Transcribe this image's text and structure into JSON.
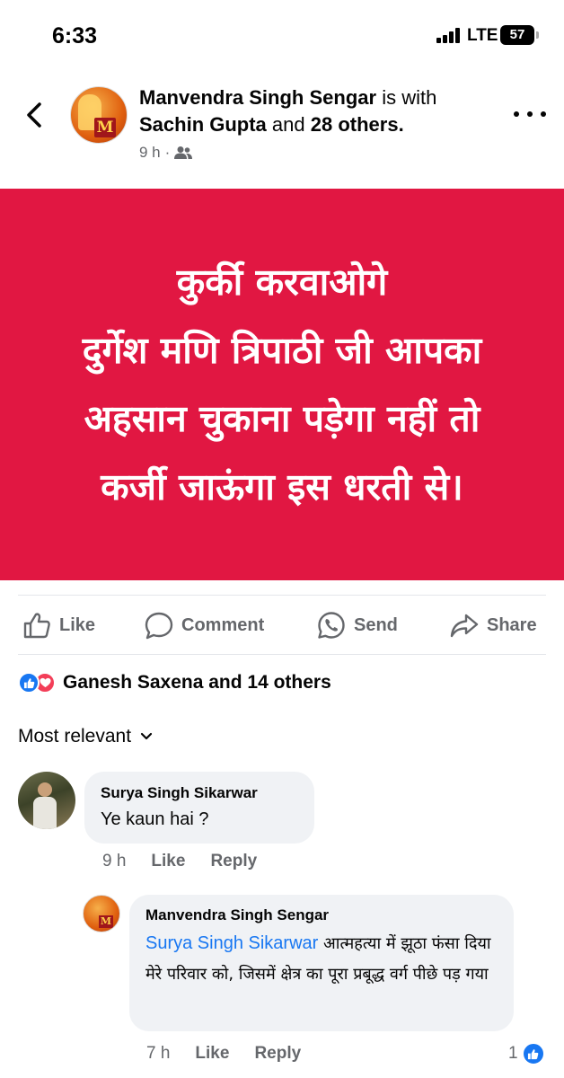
{
  "status_bar": {
    "time": "6:33",
    "network": "LTE",
    "battery": "57"
  },
  "post": {
    "author": "Manvendra Singh Sengar",
    "with_text": "is with",
    "tagged": "Sachin Gupta",
    "and_text": "and",
    "others": "28 others.",
    "time": "9 h",
    "dot": "·",
    "audience_icon": "friends-icon",
    "avatar_monogram": "M",
    "image_text": "कुर्की करवाओगे\nदुर्गेश मणि त्रिपाठी जी आपका\nअहसान चुकाना पड़ेगा नहीं तो\nकर्जी जाऊंगा इस धरती से।",
    "image_bg": "#e11742"
  },
  "actions": {
    "like": "Like",
    "comment": "Comment",
    "send": "Send",
    "share": "Share"
  },
  "reactions": {
    "summary": "Ganesh Saxena and 14 others",
    "like_color": "#1877f2",
    "love_color": "#f33e58"
  },
  "filter": {
    "label": "Most relevant"
  },
  "comments": [
    {
      "name": "Surya Singh Sikarwar",
      "text": "Ye kaun hai ?",
      "time": "9 h",
      "like": "Like",
      "reply": "Reply"
    },
    {
      "name": "Manvendra Singh Sengar",
      "mention": "Surya Singh Sikarwar",
      "text": "आत्महत्या में झूठा फंसा दिया मेरे परिवार को, जिसमें क्षेत्र का पूरा प्रबूद्ध वर्ग पीछे पड़ गया",
      "time": "7 h",
      "like": "Like",
      "reply": "Reply",
      "reaction_count": "1",
      "avatar_monogram": "M"
    }
  ]
}
